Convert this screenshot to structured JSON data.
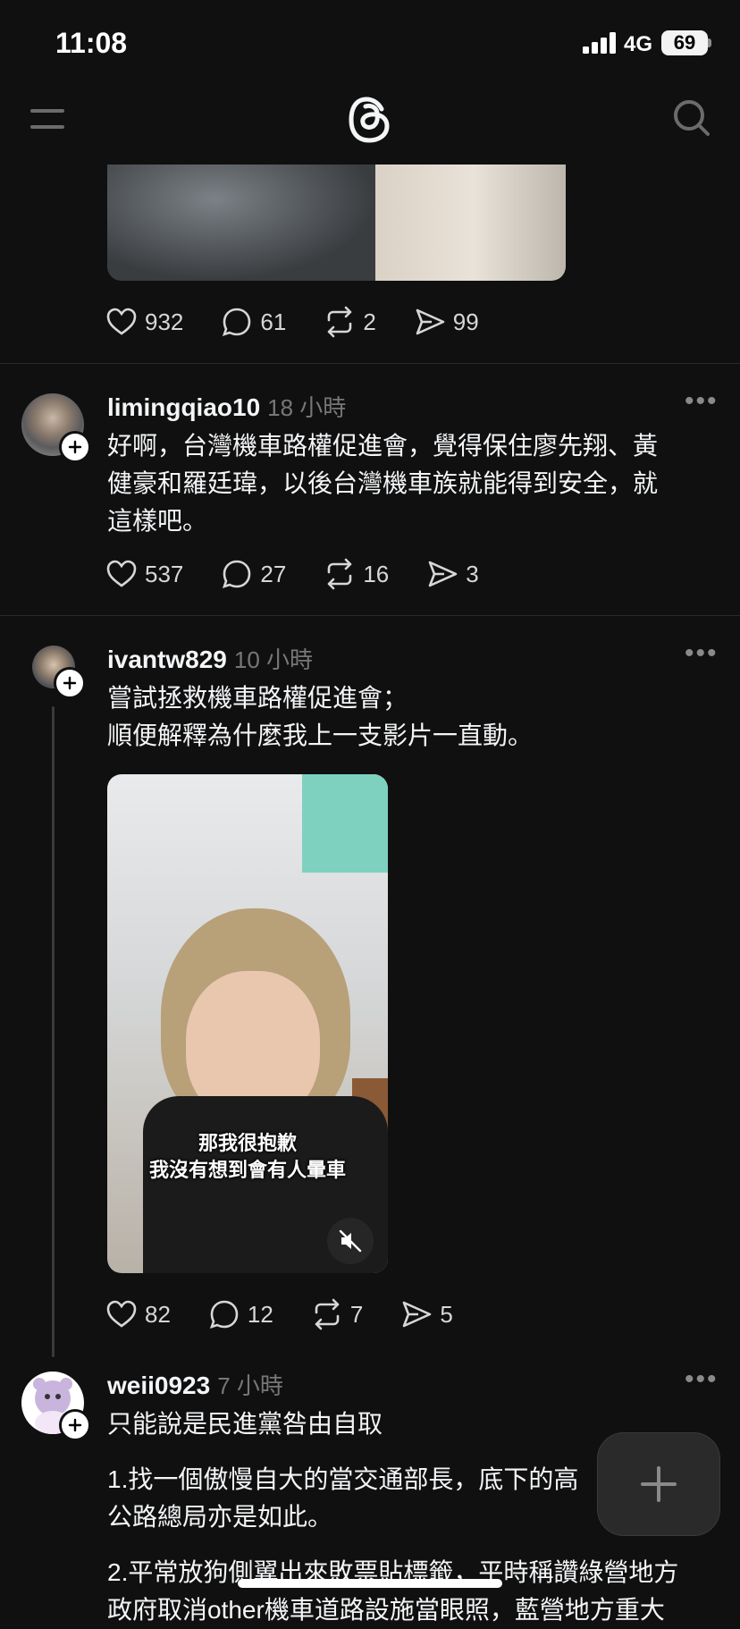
{
  "status_bar": {
    "time": "11:08",
    "network": "4G",
    "battery": "69"
  },
  "nav": {
    "menu_icon": "menu-icon",
    "logo_icon": "threads-logo-icon",
    "search_icon": "search-icon"
  },
  "posts": [
    {
      "stats": {
        "likes": "932",
        "replies": "61",
        "reposts": "2",
        "shares": "99"
      }
    },
    {
      "username": "limingqiao10",
      "time": "18 小時",
      "lines": [
        "好啊，台灣機車路權促進會，覺得保住廖先翔、黃",
        "健豪和羅廷瑋，以後台灣機車族就能得到安全，就",
        "這樣吧。"
      ],
      "stats": {
        "likes": "537",
        "replies": "27",
        "reposts": "16",
        "shares": "3"
      }
    },
    {
      "username": "ivantw829",
      "time": "10 小時",
      "lines": [
        "嘗試拯救機車路權促進會；",
        "順便解釋為什麼我上一支影片一直動。"
      ],
      "video_caption": [
        "那我很抱歉",
        "我沒有想到會有人暈車"
      ],
      "stats": {
        "likes": "82",
        "replies": "12",
        "reposts": "7",
        "shares": "5"
      }
    },
    {
      "username": "weii0923",
      "time": "7 小時",
      "lines": [
        "只能說是民進黨咎由自取"
      ],
      "para1": [
        "1.找一個傲慢自大的當交通部長，底下的高",
        "公路總局亦是如此。"
      ],
      "para2": [
        "2.平常放狗側翼出來敗票貼標籤，平時稱讚綠營地方",
        "政府取消other機車道路設施當眼照，藍營地方重大"
      ]
    }
  ],
  "colors": {
    "background": "#101010",
    "text": "#f3f5f7",
    "muted": "#777777",
    "divider": "#2a2a2a"
  }
}
